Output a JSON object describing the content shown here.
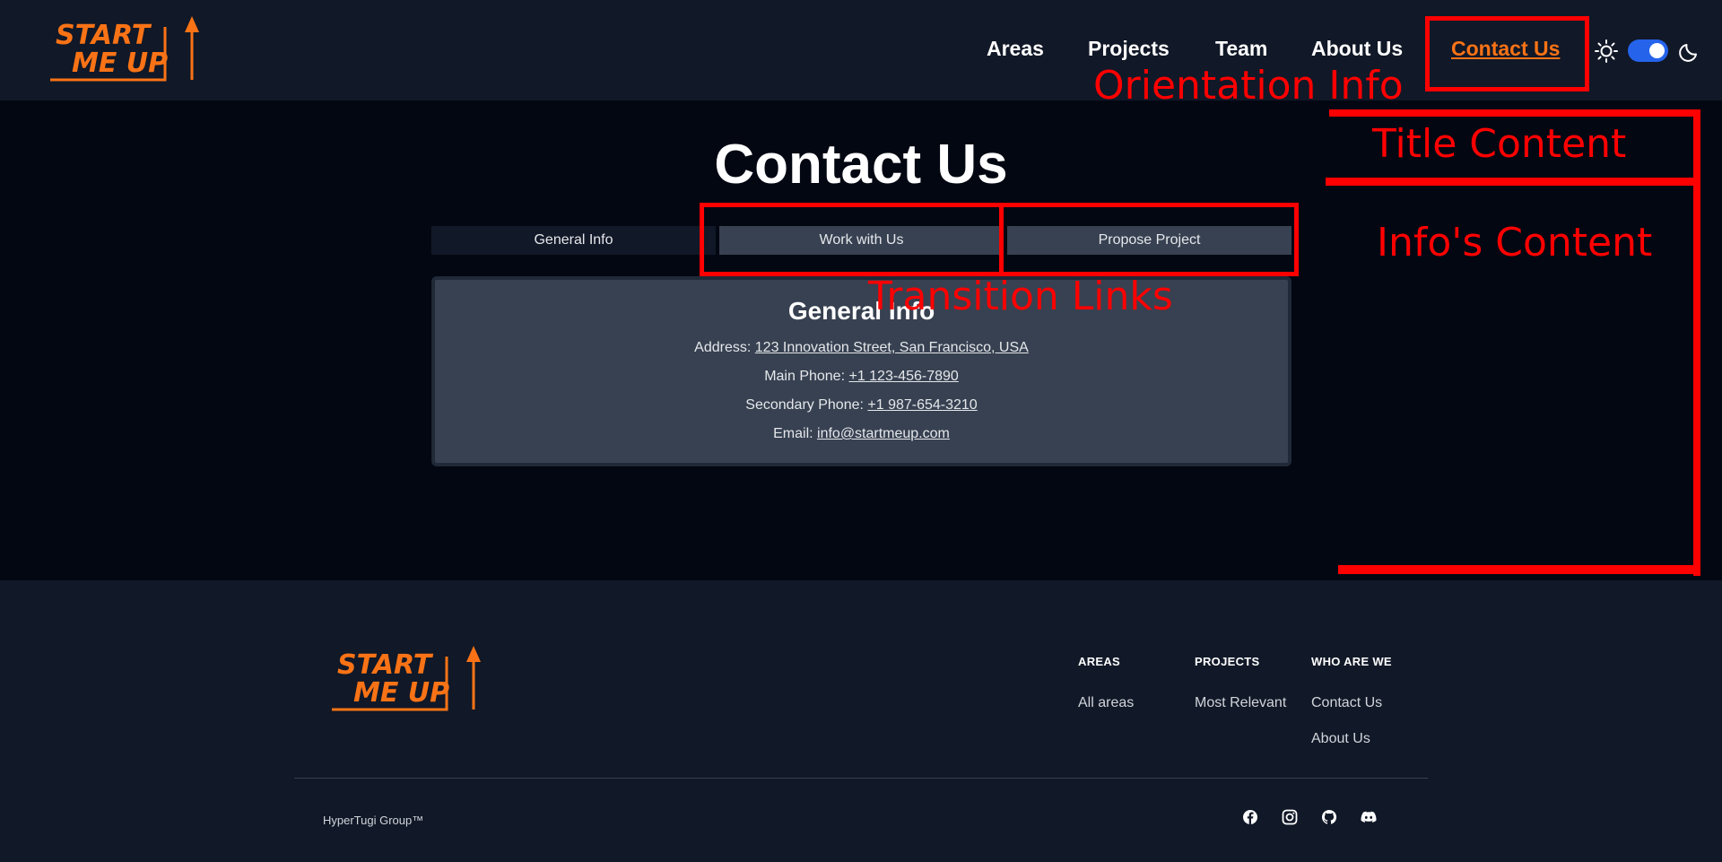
{
  "header": {
    "logo_line1": "START",
    "logo_line2": "ME UP",
    "nav": [
      "Areas",
      "Projects",
      "Team",
      "About Us",
      "Contact Us"
    ],
    "active_nav": "Contact Us",
    "theme_toggle": "on"
  },
  "main": {
    "title": "Contact Us",
    "tabs": [
      "General Info",
      "Work with Us",
      "Propose Project"
    ],
    "active_tab": "General Info",
    "card": {
      "title": "General Info",
      "address_label": "Address: ",
      "address": "123 Innovation Street, San Francisco, USA",
      "main_phone_label": "Main Phone: ",
      "main_phone": "+1 123-456-7890",
      "secondary_phone_label": "Secondary Phone: ",
      "secondary_phone": "+1 987-654-3210",
      "email_label": "Email: ",
      "email": "info@startmeup.com"
    }
  },
  "annotations": {
    "orientation": "Orientation Info",
    "title_content": "Title Content",
    "info_content": "Info's Content",
    "transition": "Transition Links"
  },
  "footer": {
    "columns": [
      {
        "heading": "AREAS",
        "links": [
          "All areas"
        ]
      },
      {
        "heading": "PROJECTS",
        "links": [
          "Most Relevant"
        ]
      },
      {
        "heading": "WHO ARE WE",
        "links": [
          "Contact Us",
          "About Us"
        ]
      }
    ],
    "copyright": "HyperTugi Group™",
    "social_icons": [
      "facebook-icon",
      "instagram-icon",
      "github-icon",
      "discord-icon"
    ]
  },
  "colors": {
    "brand": "#f97316",
    "header_bg": "#111827",
    "page_bg": "#030712",
    "toggle": "#2563eb",
    "annotation": "#ff0000"
  }
}
